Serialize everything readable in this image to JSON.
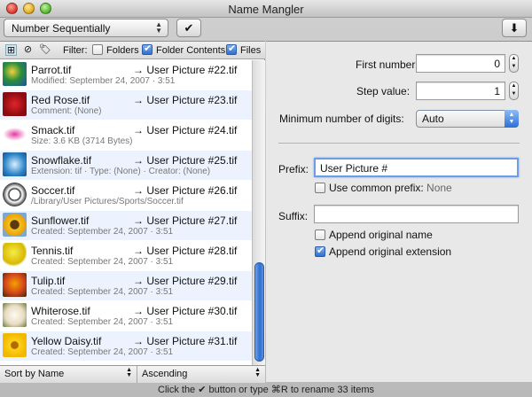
{
  "window": {
    "title": "Name Mangler"
  },
  "toolbar": {
    "mode": "Number Sequentially",
    "apply_icon": "checkmark-icon",
    "output_icon": "download-arrow-icon"
  },
  "filter": {
    "label": "Filter:",
    "folders": {
      "label": "Folders",
      "checked": false
    },
    "folder_contents": {
      "label": "Folder Contents",
      "checked": true
    },
    "files": {
      "label": "Files",
      "checked": true
    }
  },
  "files": [
    {
      "name": "Parrot.tif",
      "new_name": "→ User Picture #22.tif",
      "detail": "Modified: September 24, 2007 · 3:51"
    },
    {
      "name": "Red Rose.tif",
      "new_name": "→ User Picture #23.tif",
      "detail": "Comment: (None)"
    },
    {
      "name": "Smack.tif",
      "new_name": "→ User Picture #24.tif",
      "detail": "Size: 3.6 KB (3714 Bytes)"
    },
    {
      "name": "Snowflake.tif",
      "new_name": "→ User Picture #25.tif",
      "detail": "Extension: tif · Type: (None) · Creator: (None)"
    },
    {
      "name": "Soccer.tif",
      "new_name": "→ User Picture #26.tif",
      "detail": "/Library/User Pictures/Sports/Soccer.tif"
    },
    {
      "name": "Sunflower.tif",
      "new_name": "→ User Picture #27.tif",
      "detail": "Created: September 24, 2007 · 3:51"
    },
    {
      "name": "Tennis.tif",
      "new_name": "→ User Picture #28.tif",
      "detail": "Created: September 24, 2007 · 3:51"
    },
    {
      "name": "Tulip.tif",
      "new_name": "→ User Picture #29.tif",
      "detail": "Created: September 24, 2007 · 3:51"
    },
    {
      "name": "Whiterose.tif",
      "new_name": "→ User Picture #30.tif",
      "detail": "Created: September 24, 2007 · 3:51"
    },
    {
      "name": "Yellow Daisy.tif",
      "new_name": "→ User Picture #31.tif",
      "detail": "Created: September 24, 2007 · 3:51"
    }
  ],
  "sort": {
    "by": "Sort by Name",
    "order": "Ascending"
  },
  "options": {
    "first_number_label": "First number:",
    "first_number": "0",
    "step_label": "Step value:",
    "step": "1",
    "min_digits_label": "Minimum number of digits:",
    "min_digits": "Auto",
    "prefix_label": "Prefix:",
    "prefix": "User Picture #",
    "common_prefix_label": "Use common prefix:",
    "common_prefix_value": "None",
    "suffix_label": "Suffix:",
    "suffix": "",
    "append_name_label": "Append original name",
    "append_name": false,
    "append_ext_label": "Append original extension",
    "append_ext": true
  },
  "status": "Click the ✔ button or type ⌘R to rename 33 items"
}
